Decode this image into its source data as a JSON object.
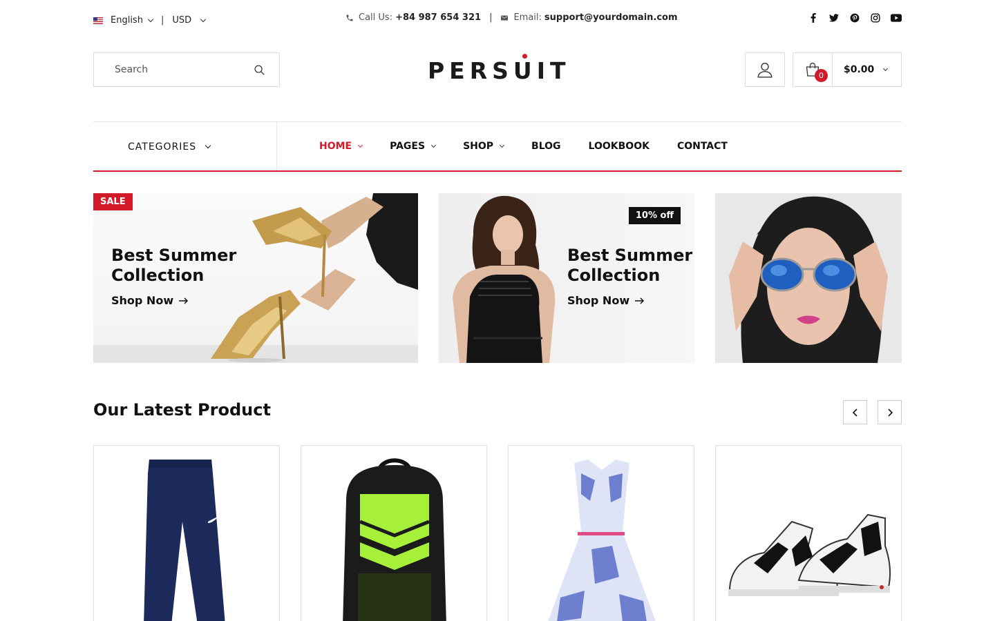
{
  "topbar": {
    "language": "English",
    "currency": "USD",
    "call_label": "Call Us:",
    "call_number": "+84 987 654 321",
    "email_label": "Email:",
    "email": "support@yourdomain.com",
    "social_icons": [
      "facebook-icon",
      "twitter-icon",
      "pinterest-icon",
      "instagram-icon",
      "youtube-icon"
    ]
  },
  "header": {
    "search_placeholder": "Search",
    "logo": "PERSUIT",
    "cart_count": "0",
    "cart_total": "$0.00"
  },
  "nav": {
    "categories_label": "CATEGORIES",
    "items": [
      {
        "label": "HOME",
        "active": true,
        "dropdown": true
      },
      {
        "label": "PAGES",
        "dropdown": true
      },
      {
        "label": "SHOP",
        "dropdown": true
      },
      {
        "label": "BLOG"
      },
      {
        "label": "LOOKBOOK"
      },
      {
        "label": "CONTACT"
      }
    ]
  },
  "banners": [
    {
      "tag": "SALE",
      "title_line1": "Best Summer",
      "title_line2": "Collection",
      "cta": "Shop Now"
    },
    {
      "tag": "10% off",
      "title_line1": "Best Summer",
      "title_line2": "Collection",
      "cta": "Shop Now"
    }
  ],
  "latest": {
    "title": "Our Latest Product"
  },
  "colors": {
    "accent": "#d31a2a",
    "text": "#111111",
    "border": "#dddddd"
  }
}
